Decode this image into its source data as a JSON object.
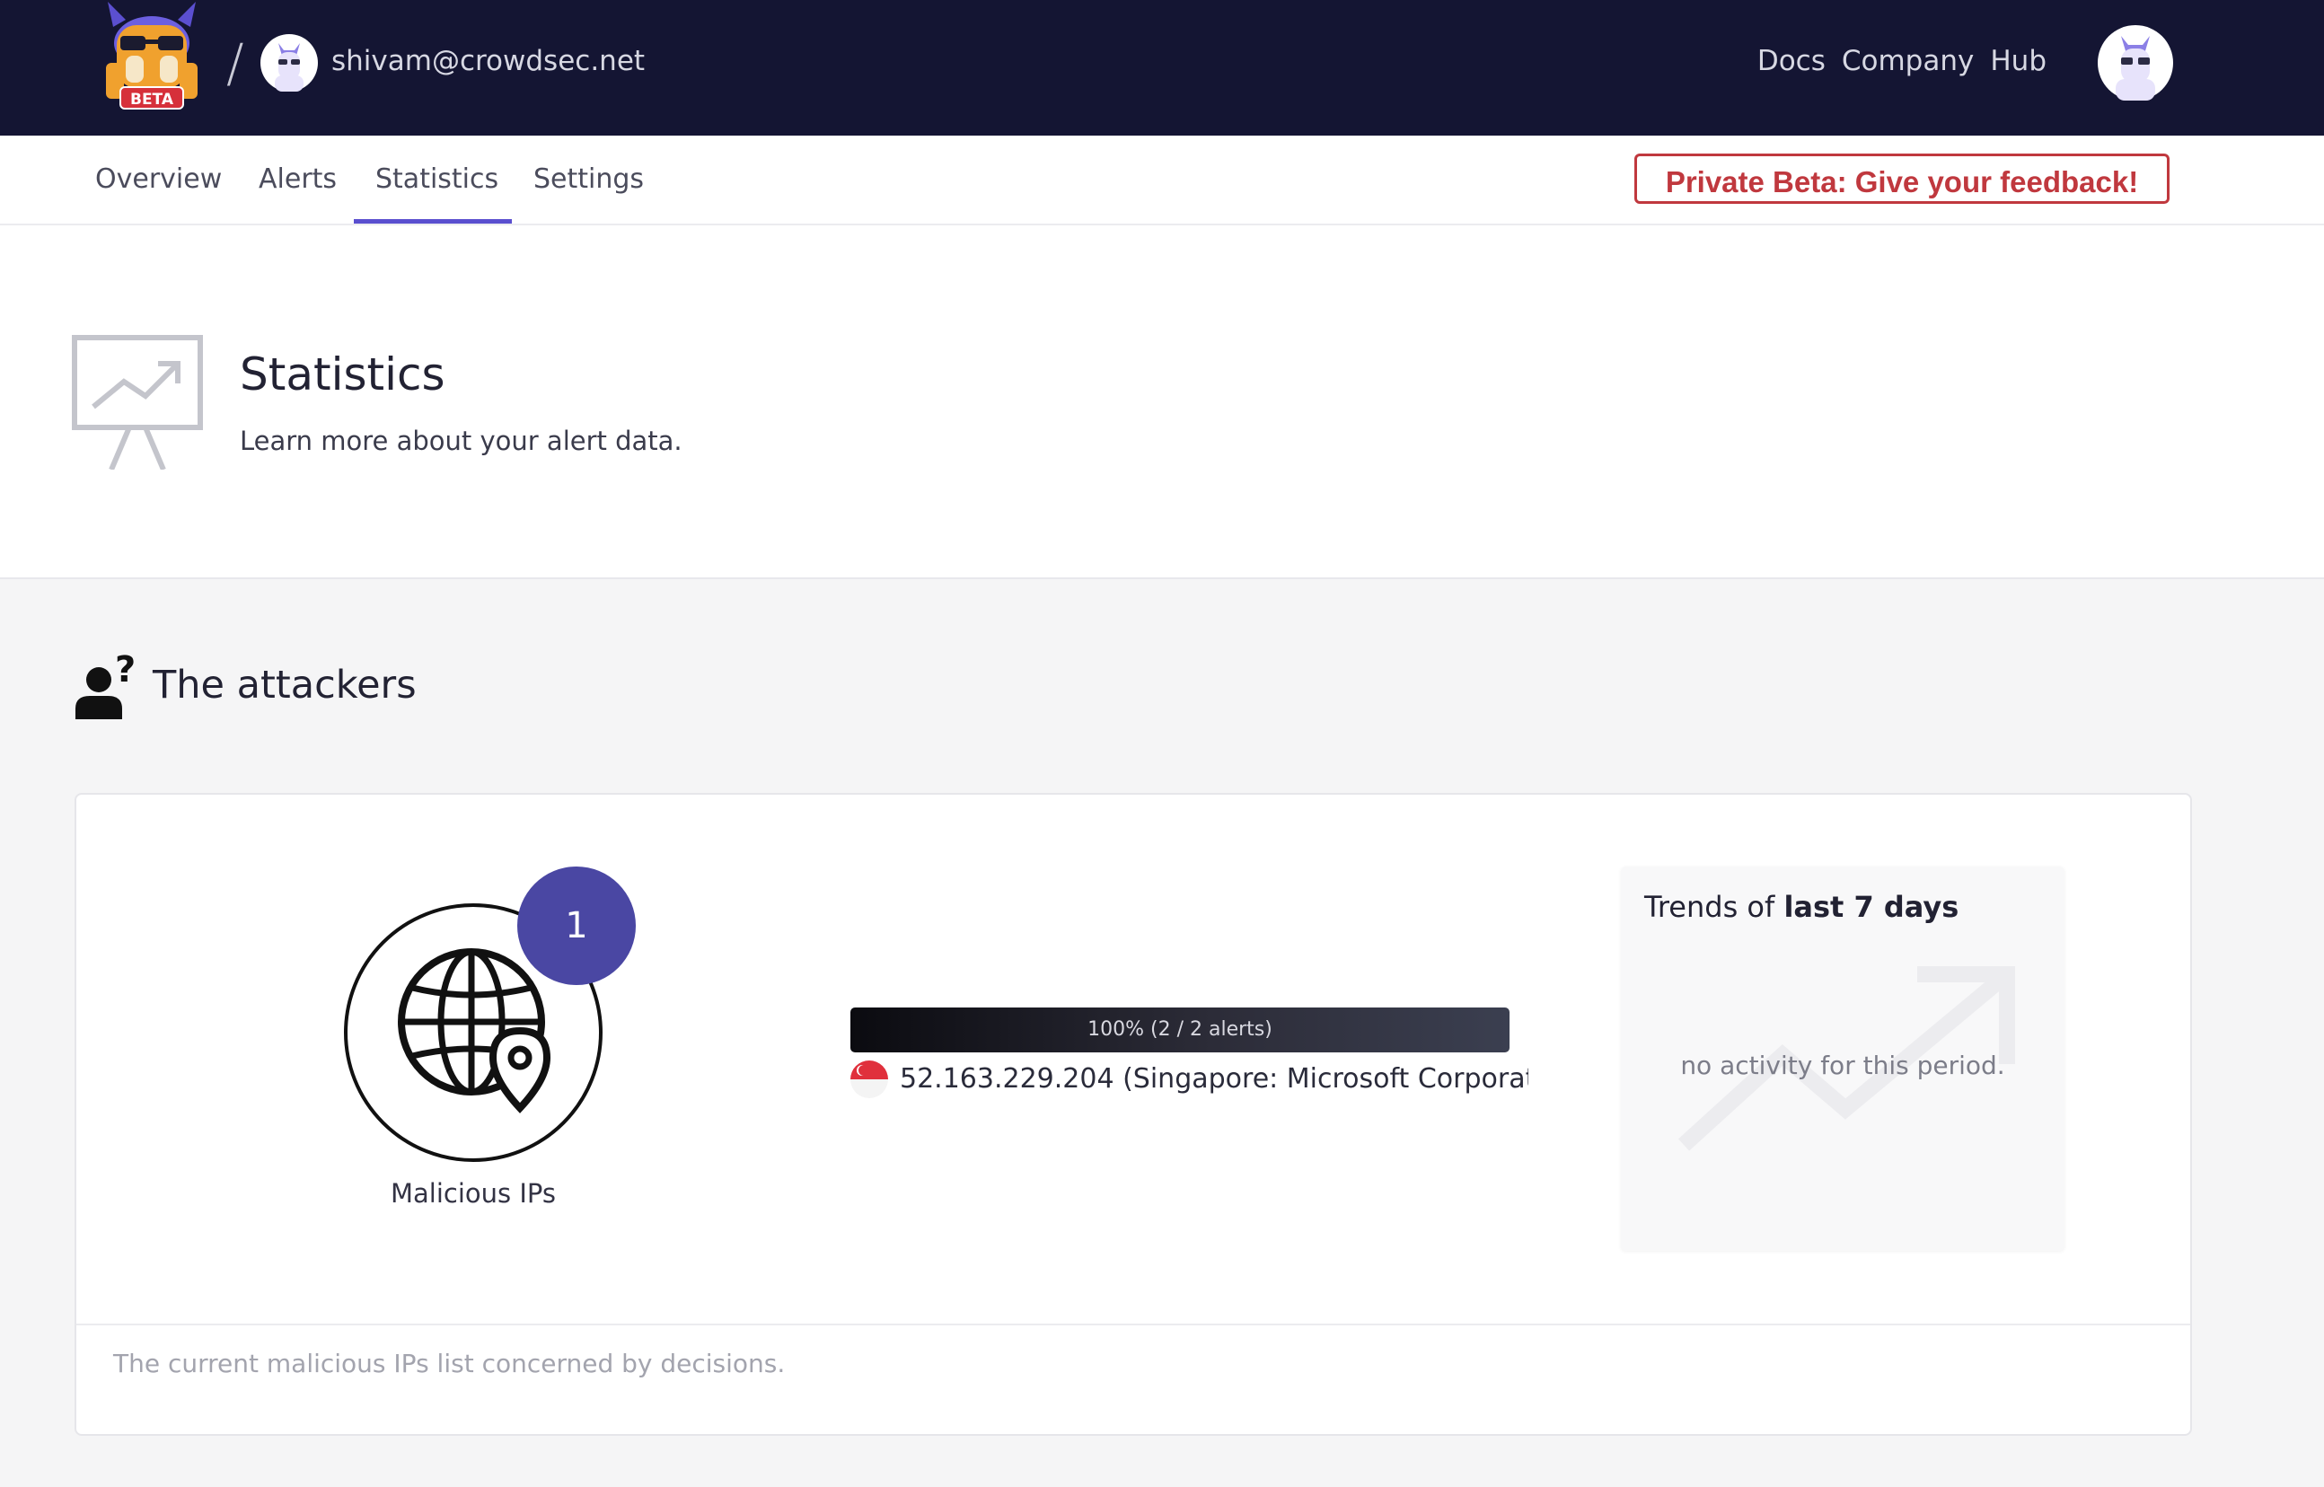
{
  "topbar": {
    "logo_badge": "BETA",
    "separator": "/",
    "user_email": "shivam@crowdsec.net",
    "links": [
      "Docs",
      "Company",
      "Hub"
    ]
  },
  "tabs": [
    {
      "label": "Overview",
      "active": false
    },
    {
      "label": "Alerts",
      "active": false
    },
    {
      "label": "Statistics",
      "active": true
    },
    {
      "label": "Settings",
      "active": false
    }
  ],
  "feedback_button": "Private Beta: Give your feedback!",
  "header": {
    "title": "Statistics",
    "subtitle": "Learn more about your alert data."
  },
  "attackers": {
    "title": "The attackers",
    "malicious_ips_count": "1",
    "malicious_ips_label": "Malicious IPs",
    "bar_label": "100% (2 / 2 alerts)",
    "bar_percent": 100,
    "ip_entry": "52.163.229.204 (Singapore: Microsoft Corporat...",
    "trend_prefix": "Trends of ",
    "trend_period": "last 7 days",
    "trend_empty": "no activity for this period.",
    "footer": "The current malicious IPs list concerned by decisions."
  },
  "colors": {
    "topbar": "#141533",
    "accent": "#5a4fcf",
    "badge": "#4a47a3",
    "feedback": "#c0383e"
  },
  "icons": {
    "logo": "crowdsec-llama-logo",
    "header": "presentation-chart-icon",
    "section": "user-question-icon",
    "globe": "globe-pin-icon",
    "flag": "singapore-flag-icon",
    "trend": "trend-arrow-icon"
  }
}
